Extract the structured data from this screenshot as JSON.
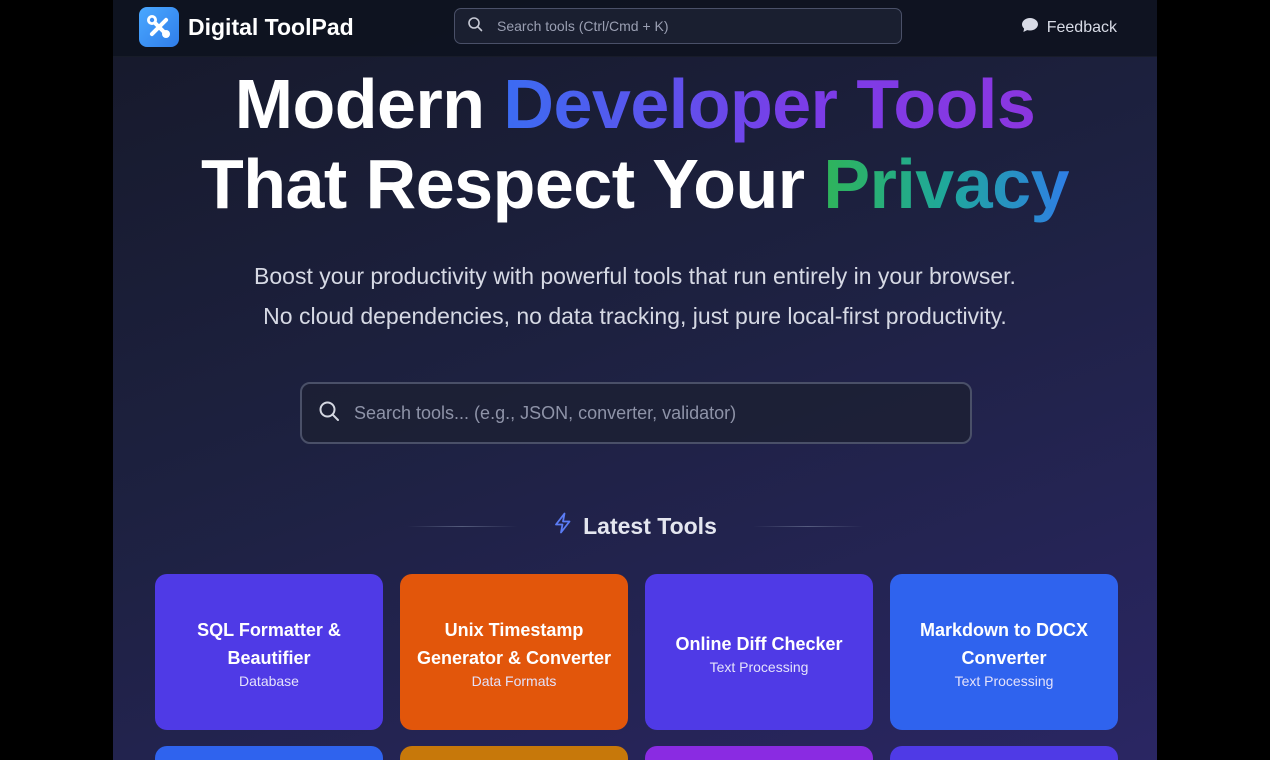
{
  "header": {
    "brand_name": "Digital ToolPad",
    "search_placeholder": "Search tools (Ctrl/Cmd + K)",
    "feedback_label": "Feedback"
  },
  "hero": {
    "title_line1_plain": "Modern ",
    "title_line1_accent": "Developer Tools",
    "title_line2_plain": "That Respect Your ",
    "title_line2_accent": "Privacy",
    "subtitle_line1": "Boost your productivity with powerful tools that run entirely in your browser.",
    "subtitle_line2": "No cloud dependencies, no data tracking, just pure local-first productivity.",
    "search_placeholder": "Search tools... (e.g., JSON, converter, validator)"
  },
  "latest": {
    "title": "Latest Tools",
    "cards": [
      {
        "name": "SQL Formatter & Beautifier",
        "category": "Database",
        "color": "#4f3ae6"
      },
      {
        "name": "Unix Timestamp Generator & Converter",
        "category": "Data Formats",
        "color": "#e2560b"
      },
      {
        "name": "Online Diff Checker",
        "category": "Text Processing",
        "color": "#4f3ae6"
      },
      {
        "name": "Markdown to DOCX Converter",
        "category": "Text Processing",
        "color": "#2f63ee"
      }
    ],
    "next_row_colors": [
      "#2f63ee",
      "#c7780a",
      "#8a2be2",
      "#4f3ae6"
    ]
  },
  "icons": {
    "logo": "tools-icon",
    "top_search": "search-icon",
    "feedback": "chat-bubble-icon",
    "main_search": "search-icon",
    "section": "lightning-icon"
  }
}
